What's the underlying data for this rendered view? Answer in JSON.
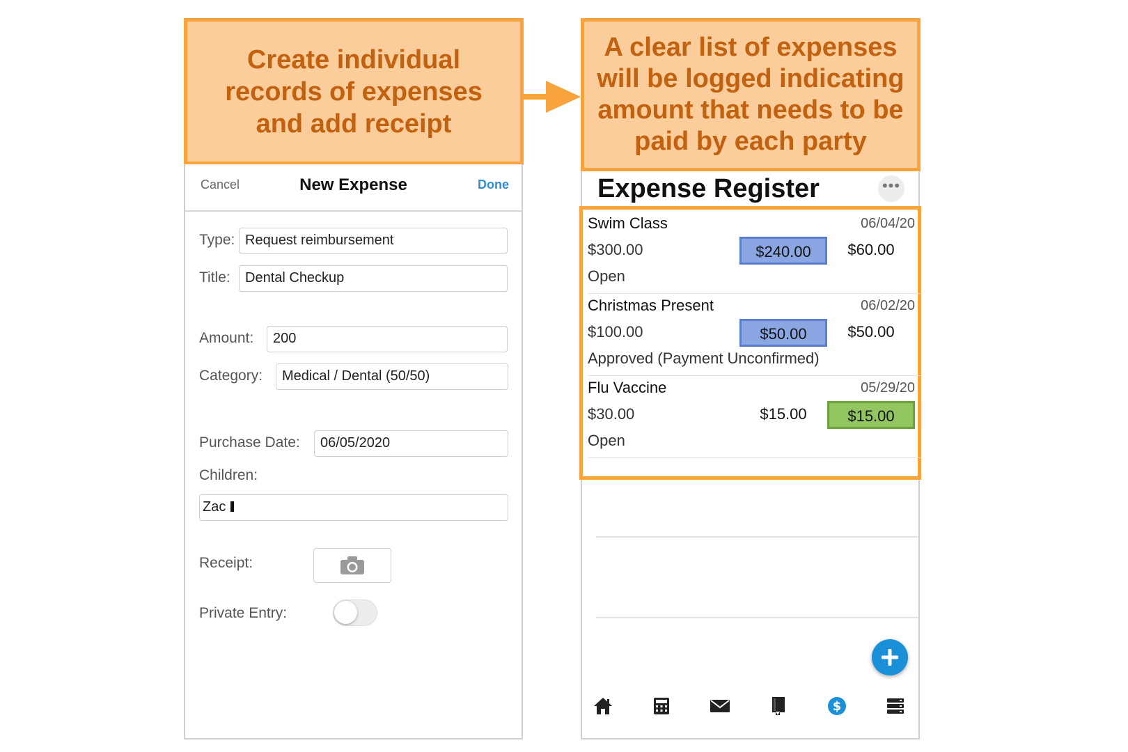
{
  "callouts": {
    "left": "Create individual records of expenses and add receipt",
    "right": "A clear list of expenses will be logged indicating amount that needs to be paid by each party"
  },
  "new_expense": {
    "cancel_label": "Cancel",
    "title": "New Expense",
    "done_label": "Done",
    "fields": {
      "type_label": "Type:",
      "type_value": "Request reimbursement",
      "title_label": "Title:",
      "title_value": "Dental Checkup",
      "amount_label": "Amount:",
      "amount_value": "200",
      "category_label": "Category:",
      "category_value": "Medical / Dental (50/50)",
      "purchase_date_label": "Purchase Date:",
      "purchase_date_value": "06/05/2020",
      "children_label": "Children:",
      "children_value": "Zac",
      "receipt_label": "Receipt:",
      "private_label": "Private Entry:"
    },
    "private_entry_on": false,
    "receipt_icon": "camera-icon"
  },
  "register": {
    "title": "Expense Register",
    "more_label": "•••",
    "entries": [
      {
        "title": "Swim Class",
        "date": "06/04/20",
        "amount": "$300.00",
        "share_a": "$240.00",
        "share_b": "$60.00",
        "status": "Open",
        "highlight": "a"
      },
      {
        "title": "Christmas Present",
        "date": "06/02/20",
        "amount": "$100.00",
        "share_a": "$50.00",
        "share_b": "$50.00",
        "status": "Approved (Payment Unconfirmed)",
        "highlight": "a"
      },
      {
        "title": "Flu Vaccine",
        "date": "05/29/20",
        "amount": "$30.00",
        "share_a": "$15.00",
        "share_b": "$15.00",
        "status": "Open",
        "highlight": "b"
      }
    ],
    "tabs": [
      "home-icon",
      "calculator-icon",
      "mail-icon",
      "journal-icon",
      "dollar-icon",
      "storage-icon"
    ],
    "active_tab": "dollar-icon"
  },
  "colors": {
    "callout_fill": "#fbcd9a",
    "callout_border": "#f8a33c",
    "callout_text": "#c2610f",
    "accent_blue": "#1a90d9",
    "highlight_blue": "#8ba7e3",
    "highlight_green": "#92c460"
  }
}
